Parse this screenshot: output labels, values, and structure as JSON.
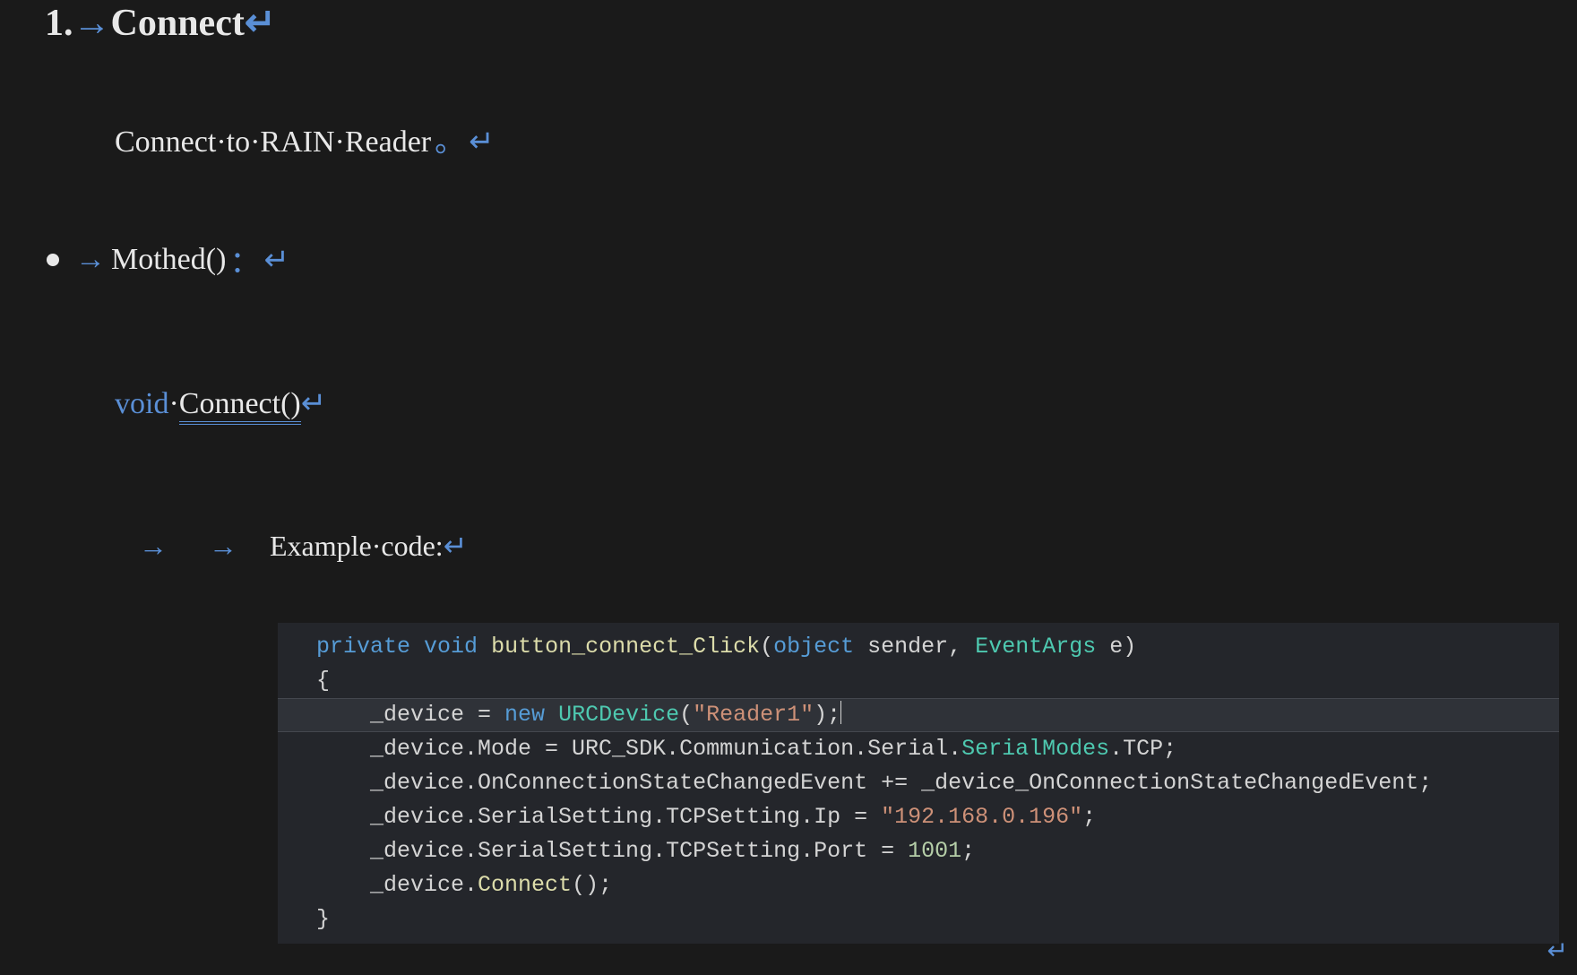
{
  "glyphs": {
    "tab_arrow": "→",
    "return": "↵",
    "mid_dot": "·",
    "period_fw": "。",
    "colon_fw": "："
  },
  "heading": {
    "number": "1.",
    "title": "Connect"
  },
  "intro": {
    "words": [
      "Connect",
      "to",
      "RAIN",
      "Reader"
    ]
  },
  "method": {
    "label_name": "Mothed",
    "label_paren": "()"
  },
  "signature": {
    "keyword": "void",
    "name": "Connect()"
  },
  "example_label": {
    "words": [
      "Example",
      "code"
    ],
    "trailing_colon": ":"
  },
  "code": {
    "l1": {
      "kw_private": "private",
      "kw_void": "void",
      "fn": "button_connect_Click",
      "p_open": "(",
      "kw_object": "object",
      "arg1": " sender, ",
      "type": "EventArgs",
      "arg2": " e",
      "p_close": ")"
    },
    "l2": "{",
    "l3": {
      "indent": "    ",
      "lhs": "_device = ",
      "kw_new": "new",
      "space": " ",
      "type": "URCDevice",
      "p_open": "(",
      "str": "\"Reader1\"",
      "p_close": ");"
    },
    "l4": {
      "indent": "    ",
      "text_a": "_device.Mode = URC_SDK.Communication.Serial.",
      "type": "SerialModes",
      "text_b": ".TCP;"
    },
    "l5": {
      "indent": "    ",
      "text": "_device.OnConnectionStateChangedEvent += _device_OnConnectionStateChangedEvent;"
    },
    "l6": {
      "indent": "    ",
      "text_a": "_device.SerialSetting.TCPSetting.Ip = ",
      "str": "\"192.168.0.196\"",
      "text_b": ";"
    },
    "l7": {
      "indent": "    ",
      "text_a": "_device.SerialSetting.TCPSetting.Port = ",
      "num": "1001",
      "text_b": ";"
    },
    "l8": {
      "indent": "    ",
      "text_a": "_device.",
      "fn": "Connect",
      "text_b": "();"
    },
    "l9": "}"
  }
}
